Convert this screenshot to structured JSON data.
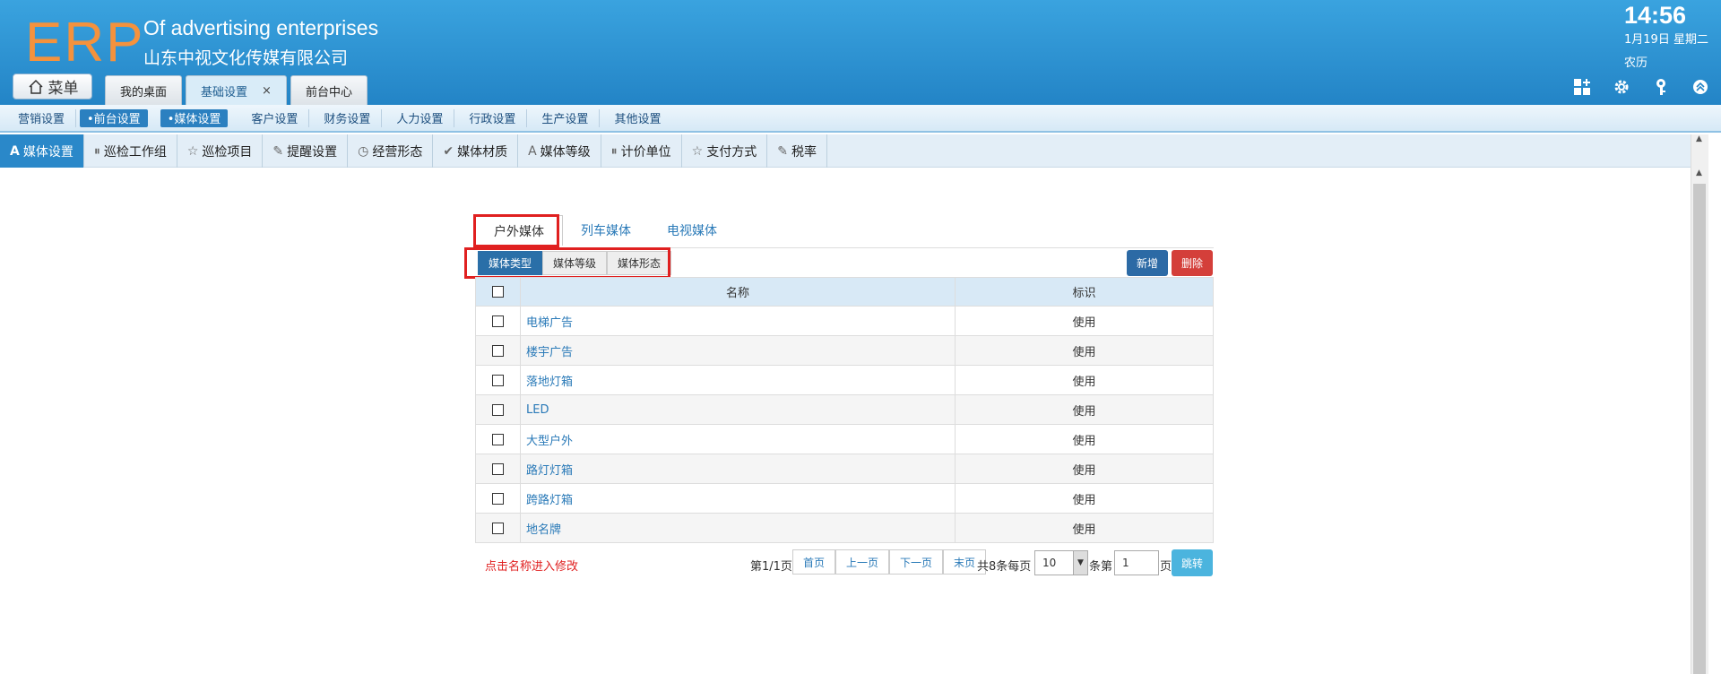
{
  "header": {
    "logo": "ERP",
    "company_en": "Of advertising enterprises",
    "company_cn": "山东中视文化传媒有限公司",
    "time": "14:56",
    "date": "1月19日 星期二",
    "lunar": "农历",
    "menu_label": "菜单",
    "tabs": [
      {
        "label": "我的桌面"
      },
      {
        "label": "基础设置",
        "close": "×"
      },
      {
        "label": "前台中心"
      }
    ],
    "icons": [
      "grid-add-icon",
      "gear-icon",
      "key-icon",
      "collapse-up-icon"
    ]
  },
  "subnav": {
    "items": [
      "营销设置",
      "•前台设置",
      "•媒体设置",
      "客户设置",
      "财务设置",
      "人力设置",
      "行政设置",
      "生产设置",
      "其他设置"
    ]
  },
  "toolnav": {
    "items": [
      {
        "icon": "A",
        "label": "媒体设置"
      },
      {
        "icon": "⏸",
        "label": "巡检工作组"
      },
      {
        "icon": "☆",
        "label": "巡检项目"
      },
      {
        "icon": "✎",
        "label": "提醒设置"
      },
      {
        "icon": "◷",
        "label": "经营形态"
      },
      {
        "icon": "✔",
        "label": "媒体材质"
      },
      {
        "icon": "A",
        "label": "媒体等级"
      },
      {
        "icon": "⏸",
        "label": "计价单位"
      },
      {
        "icon": "☆",
        "label": "支付方式"
      },
      {
        "icon": "✎",
        "label": "税率"
      }
    ]
  },
  "content": {
    "media_tabs": [
      "户外媒体",
      "列车媒体",
      "电视媒体"
    ],
    "sub_tabs": [
      "媒体类型",
      "媒体等级",
      "媒体形态"
    ],
    "add_label": "新增",
    "delete_label": "删除",
    "columns": [
      "名称",
      "标识"
    ],
    "rows": [
      {
        "name": "电梯广告",
        "flag": "使用"
      },
      {
        "name": "楼宇广告",
        "flag": "使用"
      },
      {
        "name": "落地灯箱",
        "flag": "使用"
      },
      {
        "name": "LED",
        "flag": "使用"
      },
      {
        "name": "大型户外",
        "flag": "使用"
      },
      {
        "name": "路灯灯箱",
        "flag": "使用"
      },
      {
        "name": "跨路灯箱",
        "flag": "使用"
      },
      {
        "name": "地名牌",
        "flag": "使用"
      }
    ],
    "hint": "点击名称进入修改",
    "pager": {
      "page_info": "第1/1页",
      "first": "首页",
      "prev": "上一页",
      "next": "下一页",
      "last": "末页",
      "total_text": "共8条每页",
      "page_size": "10",
      "per_label": "条第",
      "page_input": "1",
      "page_label": "页",
      "go": "跳转"
    }
  },
  "colors": {
    "header_blue": "#2384c6",
    "logo_orange": "#f4923d",
    "highlight_red": "#e02020",
    "link_blue": "#2a7ab8"
  }
}
